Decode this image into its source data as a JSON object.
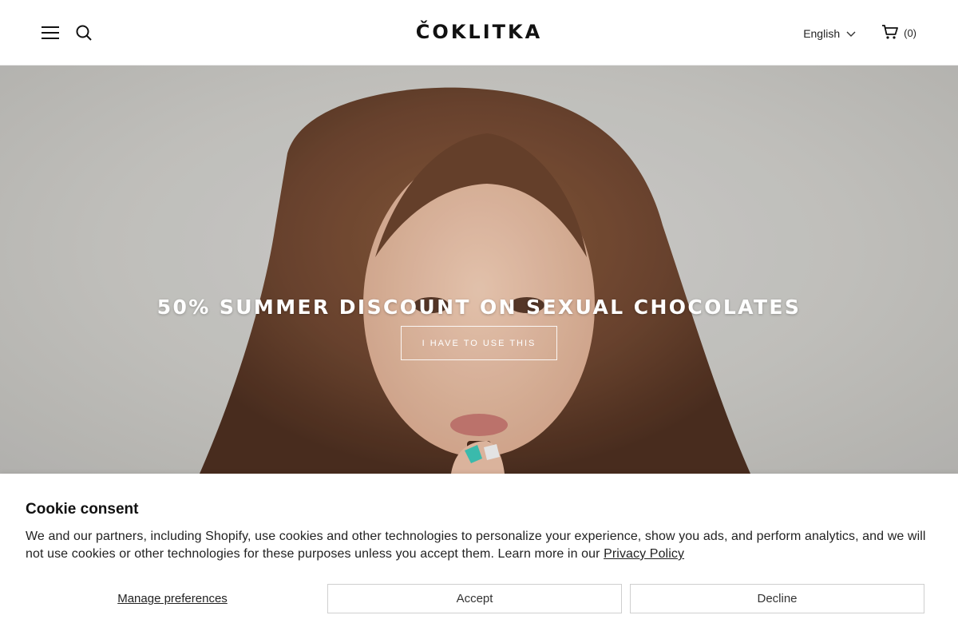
{
  "header": {
    "logo": "ČOKLITKA",
    "language": "English",
    "cart_count": "(0)"
  },
  "hero": {
    "title": "50% SUMMER DISCOUNT ON SEXUAL CHOCOLATES",
    "cta": "I HAVE TO USE THIS"
  },
  "cookie": {
    "title": "Cookie consent",
    "text": "We and our partners, including Shopify, use cookies and other technologies to personalize your experience, show you ads, and perform analytics, and we will not use cookies or other technologies for these purposes unless you accept them. Learn more in our ",
    "link": "Privacy Policy",
    "manage": "Manage preferences",
    "accept": "Accept",
    "decline": "Decline"
  }
}
